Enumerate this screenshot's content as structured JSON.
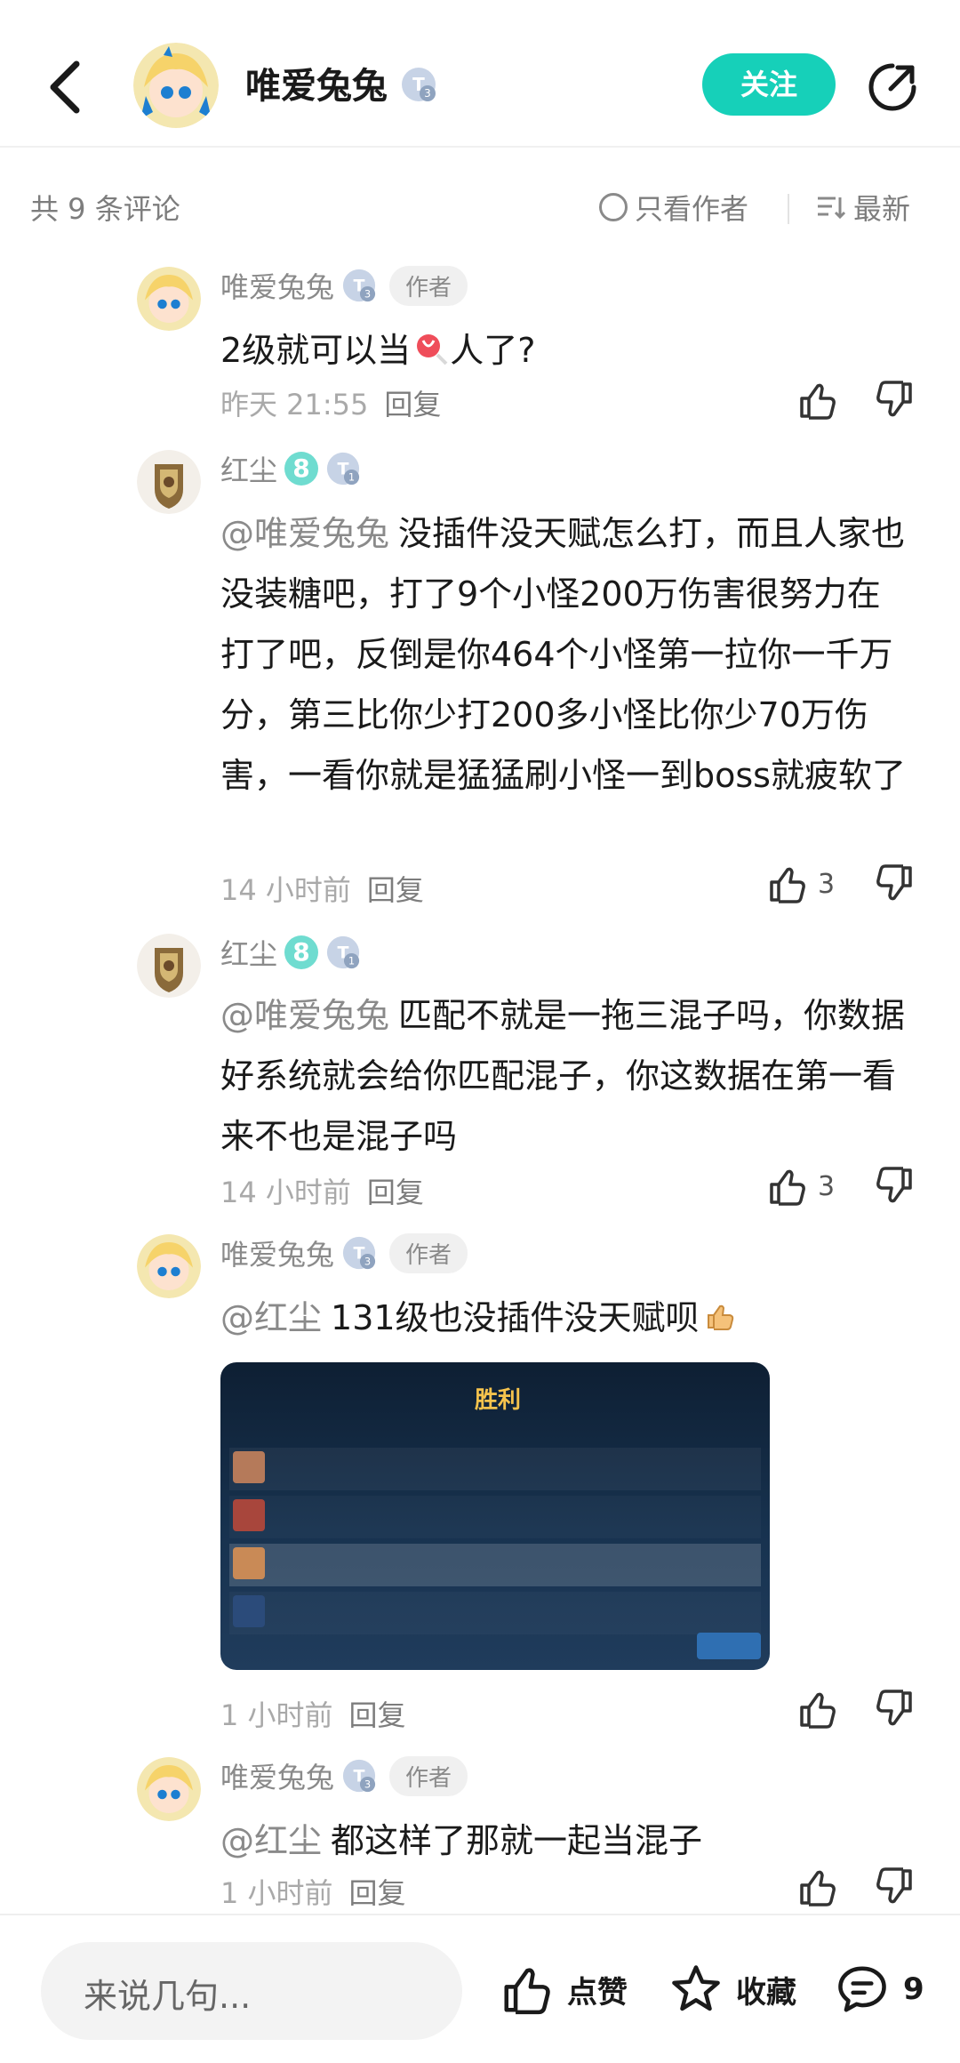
{
  "header": {
    "author_name": "唯爱兔兔",
    "level_badge": "T3",
    "follow_label": "关注"
  },
  "subheader": {
    "comment_count": "共 9 条评论",
    "author_only": "只看作者",
    "sort_label": "最新"
  },
  "comments": [
    {
      "name": "唯爱兔兔",
      "badge": "T3",
      "author_tag": "作者",
      "text_before": "2级就可以当",
      "text_after": "人了?",
      "time": "昨天 21:55",
      "reply": "回复",
      "likes": ""
    },
    {
      "name": "红尘",
      "fan_badge": "8",
      "badge": "T1",
      "mention": "@唯爱兔兔",
      "text": "没插件没天赋怎么打，而且人家也没装糖吧，打了9个小怪200万伤害很努力在打了吧，反倒是你464个小怪第一拉你一千万分，第三比你少打200多小怪比你少70万伤害，一看你就是猛猛刷小怪一到boss就疲软了",
      "time": "14 小时前",
      "reply": "回复",
      "likes": "3"
    },
    {
      "name": "红尘",
      "fan_badge": "8",
      "badge": "T1",
      "mention": "@唯爱兔兔",
      "text": "匹配不就是一拖三混子吗，你数据好系统就会给你匹配混子，你这数据在第一看来不也是混子吗",
      "time": "14 小时前",
      "reply": "回复",
      "likes": "3"
    },
    {
      "name": "唯爱兔兔",
      "badge": "T3",
      "author_tag": "作者",
      "mention": "@红尘",
      "text": "131级也没插件没天赋呗",
      "image_title": "胜利",
      "time": "1 小时前",
      "reply": "回复",
      "likes": ""
    },
    {
      "name": "唯爱兔兔",
      "badge": "T3",
      "author_tag": "作者",
      "mention": "@红尘",
      "text": "都这样了那就一起当混子",
      "time": "1 小时前",
      "reply": "回复",
      "likes": ""
    }
  ],
  "bottom_bar": {
    "input_placeholder": "来说几句...",
    "like_label": "点赞",
    "favorite_label": "收藏",
    "comment_count": "9"
  },
  "colors": {
    "accent": "#16d0b9",
    "text_primary": "#1a1a1a",
    "text_secondary": "#8a8a8a"
  }
}
